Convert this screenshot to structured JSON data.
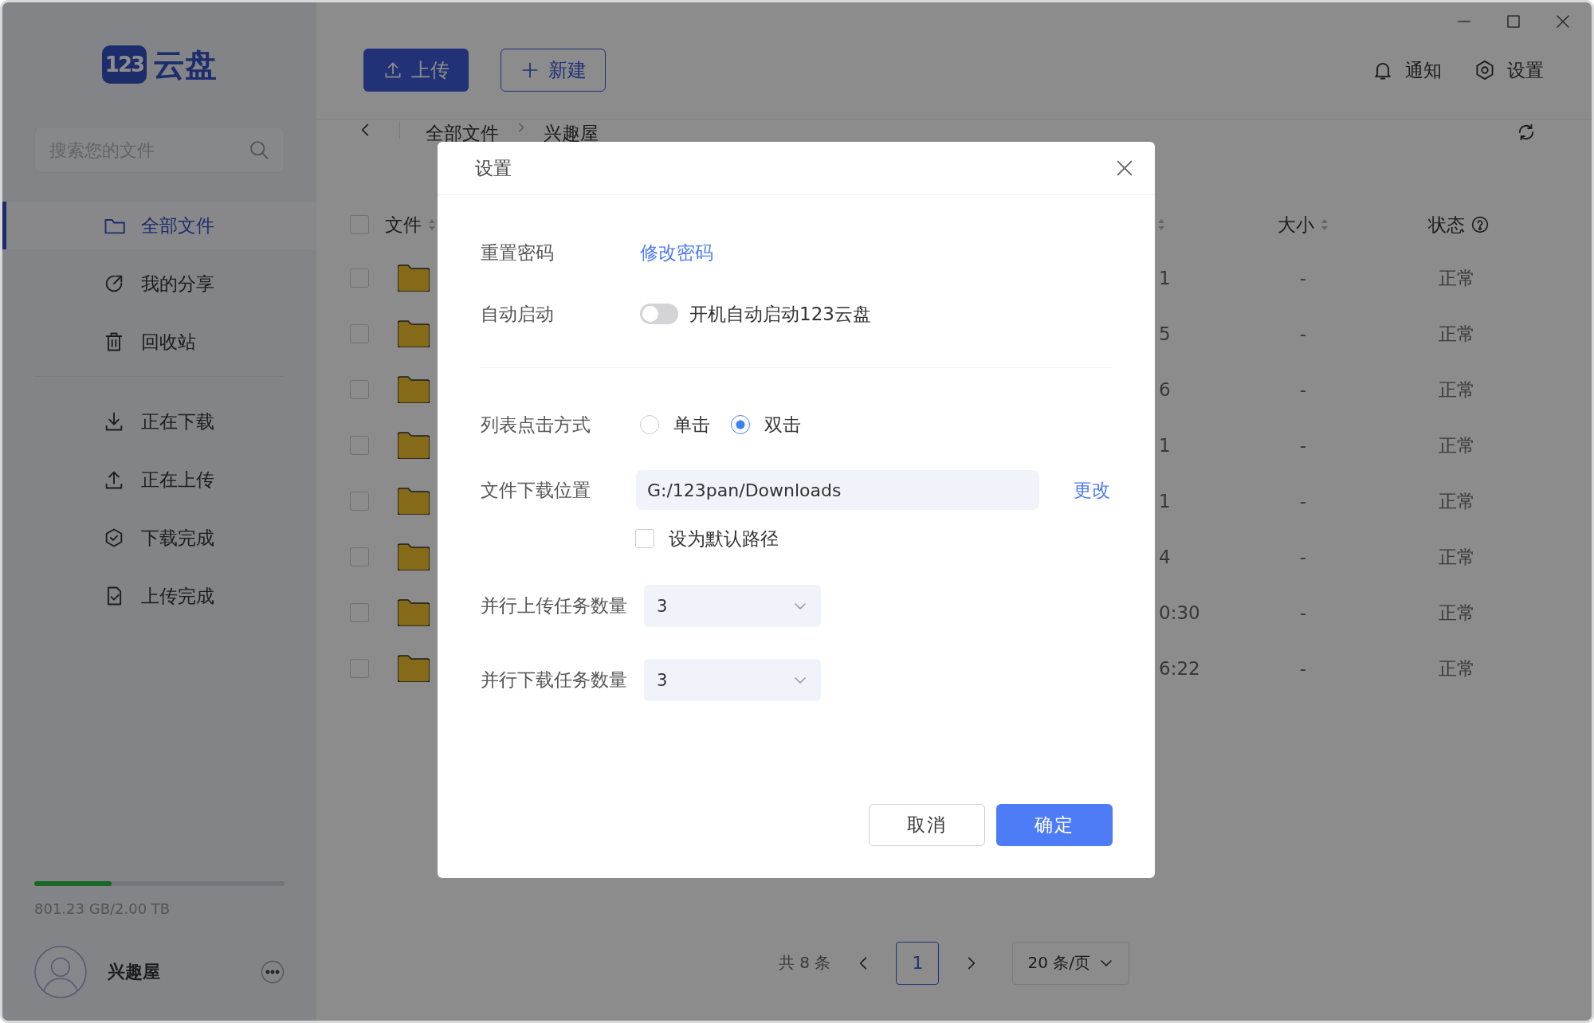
{
  "logo": {
    "badge": "123",
    "name": "云盘"
  },
  "sidebar": {
    "search": {
      "placeholder": "搜索您的文件"
    },
    "nav_groups": [
      {
        "items": [
          {
            "label": "全部文件",
            "selected": true
          },
          {
            "label": "我的分享",
            "selected": false
          },
          {
            "label": "回收站",
            "selected": false
          }
        ]
      },
      {
        "items": [
          {
            "label": "正在下载",
            "selected": false
          },
          {
            "label": "正在上传",
            "selected": false
          },
          {
            "label": "下载完成",
            "selected": false
          },
          {
            "label": "上传完成",
            "selected": false
          }
        ]
      }
    ],
    "storage": {
      "level": 0.31,
      "text": "801.23 GB/2.00 TB"
    },
    "user": {
      "name": "兴趣屋"
    }
  },
  "toolbar": {
    "buttons": [
      {
        "label": "上传",
        "kind": "primary"
      },
      {
        "label": "新建",
        "kind": "outline"
      }
    ],
    "actions": [
      {
        "label": "通知",
        "kind": "bell"
      },
      {
        "label": "设置",
        "kind": "gear"
      }
    ]
  },
  "breadcrumb": [
    "全部文件",
    "兴趣屋"
  ],
  "table": {
    "columns": [
      {
        "label": "文件",
        "sortable": true
      },
      {
        "sortable": true
      },
      {
        "label": "大小",
        "sortable": true
      },
      {
        "label": "状态",
        "help": true
      }
    ],
    "header_checked": false,
    "rows": [
      {
        "checked": false,
        "column_2": "1",
        "size": "-",
        "status": "正常"
      },
      {
        "checked": false,
        "column_2": "5",
        "size": "-",
        "status": "正常"
      },
      {
        "checked": false,
        "column_2": "6",
        "size": "-",
        "status": "正常"
      },
      {
        "checked": false,
        "column_2": "1",
        "size": "-",
        "status": "正常"
      },
      {
        "checked": false,
        "column_2": "1",
        "size": "-",
        "status": "正常"
      },
      {
        "checked": false,
        "column_2": "4",
        "size": "-",
        "status": "正常"
      },
      {
        "checked": false,
        "column_2": "0:30",
        "size": "-",
        "status": "正常"
      },
      {
        "checked": false,
        "column_2": "6:22",
        "size": "-",
        "status": "正常"
      }
    ]
  },
  "pagination": {
    "total": "共 8 条",
    "pages": [
      {
        "label": "1",
        "selected": true
      }
    ],
    "page_size": "20 条/页"
  },
  "dialog": {
    "title": "设置",
    "settings": [
      {
        "kind": "link",
        "label": "重置密码",
        "link": "修改密码"
      },
      {
        "kind": "toggle",
        "label": "自动启动",
        "on": false,
        "text": "开机自动启动123云盘"
      },
      {
        "kind": "divider"
      },
      {
        "kind": "radio",
        "label": "列表点击方式",
        "options": [
          {
            "label": "单击",
            "selected": false
          },
          {
            "label": "双击",
            "selected": true
          }
        ]
      },
      {
        "kind": "path",
        "label": "文件下载位置",
        "value": "G:/123pan/Downloads",
        "action": "更改"
      },
      {
        "kind": "checkbox",
        "label": "设为默认路径",
        "checked": false
      },
      {
        "kind": "select",
        "label": "并行上传任务数量",
        "value": "3"
      },
      {
        "kind": "select",
        "label": "并行下载任务数量",
        "value": "3"
      }
    ],
    "buttons": [
      {
        "label": "取消",
        "kind": "secondary"
      },
      {
        "label": "确定",
        "kind": "primary"
      }
    ]
  }
}
